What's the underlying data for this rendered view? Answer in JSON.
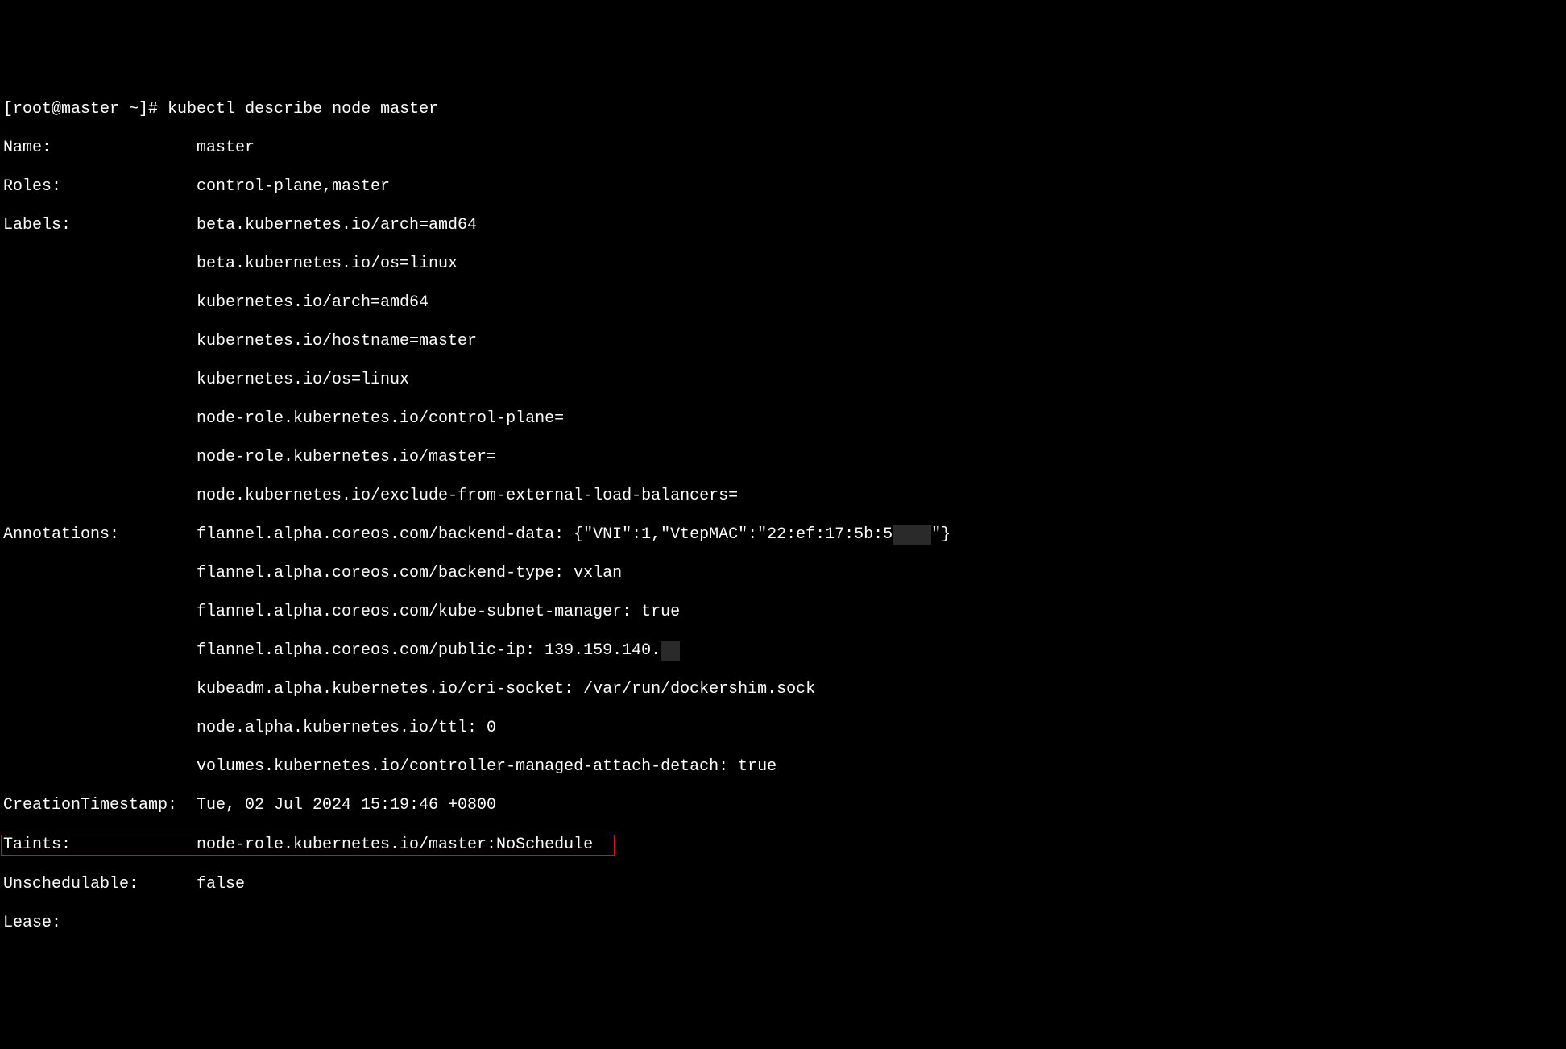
{
  "prompt": {
    "user_host": "[root@master ~]#",
    "command": "kubectl describe node master"
  },
  "fields": {
    "name": {
      "label": "Name:",
      "value": "master"
    },
    "roles": {
      "label": "Roles:",
      "value": "control-plane,master"
    },
    "labels": {
      "label": "Labels:",
      "values": [
        "beta.kubernetes.io/arch=amd64",
        "beta.kubernetes.io/os=linux",
        "kubernetes.io/arch=amd64",
        "kubernetes.io/hostname=master",
        "kubernetes.io/os=linux",
        "node-role.kubernetes.io/control-plane=",
        "node-role.kubernetes.io/master=",
        "node.kubernetes.io/exclude-from-external-load-balancers="
      ]
    },
    "annotations": {
      "label": "Annotations:",
      "values": [
        "flannel.alpha.coreos.com/backend-data: {\"VNI\":1,\"VtepMAC\":\"22:ef:17:5b:5",
        "flannel.alpha.coreos.com/backend-type: vxlan",
        "flannel.alpha.coreos.com/kube-subnet-manager: true",
        "flannel.alpha.coreos.com/public-ip: 139.159.140.",
        "kubeadm.alpha.kubernetes.io/cri-socket: /var/run/dockershim.sock",
        "node.alpha.kubernetes.io/ttl: 0",
        "volumes.kubernetes.io/controller-managed-attach-detach: true"
      ],
      "annotation0_suffix": "\"}"
    },
    "creation_timestamp": {
      "label": "CreationTimestamp:",
      "value": "Tue, 02 Jul 2024 15:19:46 +0800"
    },
    "taints": {
      "label": "Taints:",
      "value": "node-role.kubernetes.io/master:NoSchedule"
    },
    "unschedulable": {
      "label": "Unschedulable:",
      "value": "false"
    },
    "lease": {
      "label": "Lease:"
    }
  }
}
